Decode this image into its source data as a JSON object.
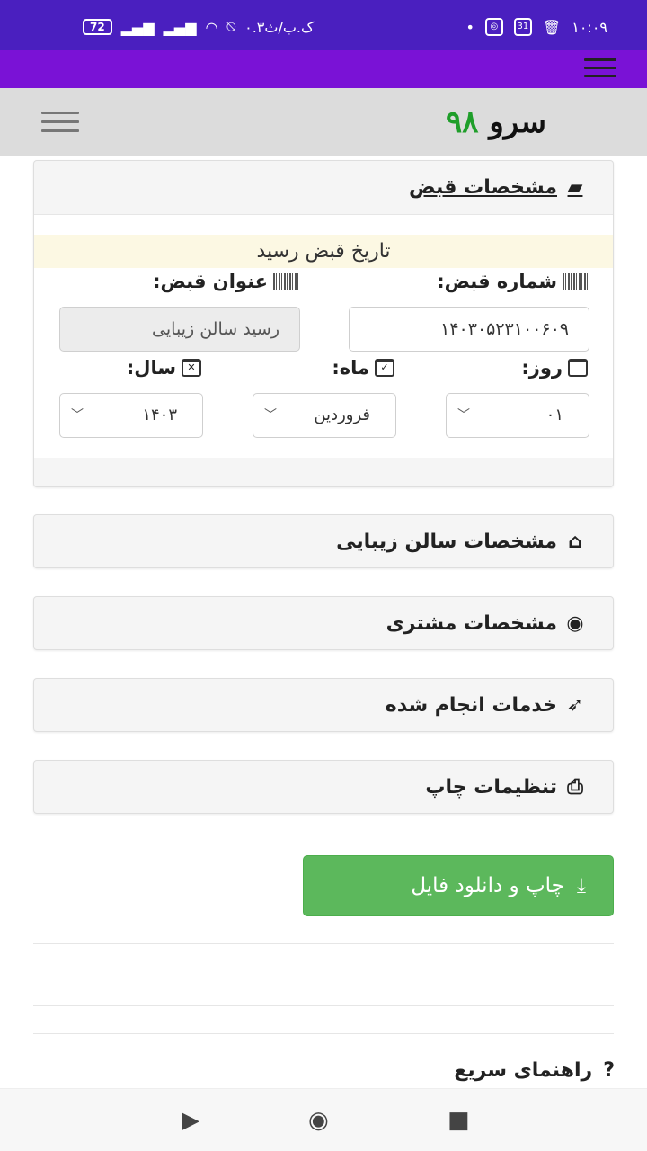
{
  "status_bar": {
    "time": "۱۰:۰۹",
    "speed": "۰.۳ک.ب/ث",
    "battery": "72",
    "calendar_day": "31"
  },
  "header": {
    "logo_word": "سرو",
    "logo_number": "۹۸"
  },
  "receipt": {
    "title": "مشخصات قبض",
    "banner": "تاریخ قبض رسید",
    "number_label": "شماره قبض:",
    "number_value": "۱۴۰۳۰۵۲۳۱۰۰۶۰۹",
    "title_label": "عنوان قبض:",
    "title_value": "رسید سالن زیبایی",
    "day_label": "روز:",
    "month_label": "ماه:",
    "year_label": "سال:",
    "day_value": "۰۱",
    "month_value": "فروردین",
    "year_value": "۱۴۰۳"
  },
  "sections": {
    "salon": "مشخصات سالن زیبایی",
    "customer": "مشخصات مشتری",
    "services": "خدمات انجام شده",
    "print": "تنظیمات چاپ"
  },
  "actions": {
    "download": "چاپ و دانلود فایل"
  },
  "help": {
    "label": "راهنمای سریع",
    "mark": "?"
  },
  "icons": {
    "receipt": "book-icon",
    "salon": "home-icon",
    "customer": "user-circle-icon",
    "services": "rocket-icon",
    "print": "printer-icon",
    "download": "download-icon"
  },
  "colors": {
    "status_bar": "#4a1fbf",
    "purple_bar": "#7a12d6",
    "logo_number": "#1f9e2a",
    "download_button": "#5cb85c",
    "banner": "#fcf8e3"
  }
}
